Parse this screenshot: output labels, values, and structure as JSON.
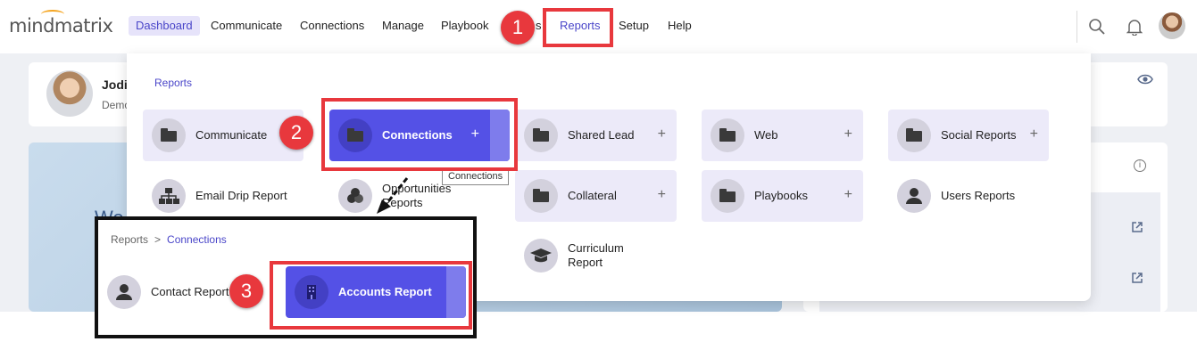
{
  "brand": {
    "logo_text": "mindmatrix",
    "accent": "#5451e6",
    "annotation_color": "#e8383d"
  },
  "nav": {
    "items": [
      "Dashboard",
      "Communicate",
      "Connections",
      "Manage",
      "Playbook",
      "Reports",
      "Setup",
      "Help"
    ],
    "active": "Dashboard",
    "highlighted": "Reports",
    "hidden_partial_text": "s"
  },
  "header_icons": [
    "search-icon",
    "bell-icon",
    "avatar"
  ],
  "profile": {
    "name": "Jodi",
    "subtitle": "Demo"
  },
  "welcome": {
    "text": "We"
  },
  "dropdown": {
    "heading": "Reports",
    "tiles": [
      {
        "label": "Communicate",
        "icon": "folder-icon",
        "expandable": false
      },
      {
        "label": "Connections",
        "icon": "folder-icon",
        "expandable": true,
        "plus": "+",
        "selected": true
      },
      {
        "label": "Shared Lead",
        "icon": "folder-icon",
        "expandable": true,
        "plus": "+"
      },
      {
        "label": "Web",
        "icon": "folder-icon",
        "expandable": true,
        "plus": "+"
      },
      {
        "label": "Social Reports",
        "icon": "folder-icon",
        "expandable": true,
        "plus": "+"
      },
      {
        "label": "Email Drip Report",
        "icon": "sitemap-icon"
      },
      {
        "label": "Opportunities Reports",
        "icon": "coins-icon"
      },
      {
        "label": "Collateral",
        "icon": "folder-icon",
        "expandable": true,
        "plus": "+"
      },
      {
        "label": "Playbooks",
        "icon": "folder-icon",
        "expandable": true,
        "plus": "+"
      },
      {
        "label": "Users Reports",
        "icon": "user-icon"
      },
      {
        "label": "Curriculum Report",
        "icon": "graduation-cap-icon"
      }
    ],
    "tooltip": "Connections"
  },
  "inset": {
    "breadcrumb": {
      "root": "Reports",
      "separator": ">",
      "current": "Connections"
    },
    "tiles": [
      {
        "label": "Contact Report",
        "icon": "user-icon"
      },
      {
        "label": "Accounts Report",
        "icon": "building-icon",
        "selected": true
      }
    ]
  },
  "annotations": {
    "steps": [
      "1",
      "2",
      "3"
    ]
  }
}
